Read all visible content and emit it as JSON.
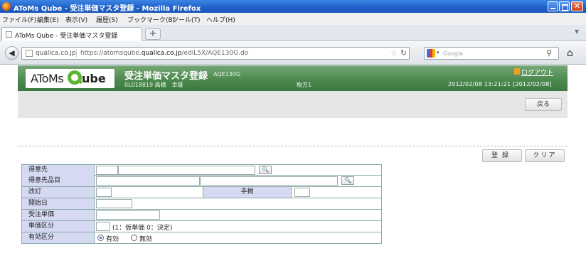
{
  "window": {
    "title": "AToMs Qube - 受注単価マスタ登録 - Mozilla Firefox"
  },
  "menu": [
    "ファイル(F)",
    "編集(E)",
    "表示(V)",
    "履歴(S)",
    "ブックマーク(B)",
    "ツール(T)",
    "ヘルプ(H)"
  ],
  "tab": {
    "title": "AToMs Qube - 受注単価マスタ登録",
    "new_tab_label": "+"
  },
  "nav": {
    "site": "qualica.co.jp",
    "url_prefix": "https://atomsqube.",
    "url_domain": "qualica.co.jp",
    "url_path": "/ediL5X/AQE130G.do",
    "search_placeholder": "Google"
  },
  "app": {
    "logo_left": "AToMs",
    "logo_right": "ube",
    "title": "受注単価マスタ登録",
    "screen_code": "AQE130G",
    "user": "0L018819 高橋　幸雄",
    "branch": "枚方1",
    "logout": "ログアウト",
    "datetime": "2012/02/08 13:21:21 [2012/02/08]"
  },
  "buttons": {
    "back": "戻る",
    "register": "登録",
    "clear": "クリア"
  },
  "form": {
    "customer_label": "得意先",
    "customer_item_label": "得意先品目",
    "revision_label": "改訂",
    "hand_over_label": "手掲",
    "start_date_label": "開始日",
    "unit_price_label": "受注単価",
    "price_category_label": "単価区分",
    "price_category_hint": "(1：仮単価 0：決定)",
    "valid_category_label": "有効区分",
    "valid_option": "有効",
    "invalid_option": "無効",
    "search_glyph": "🔍"
  }
}
